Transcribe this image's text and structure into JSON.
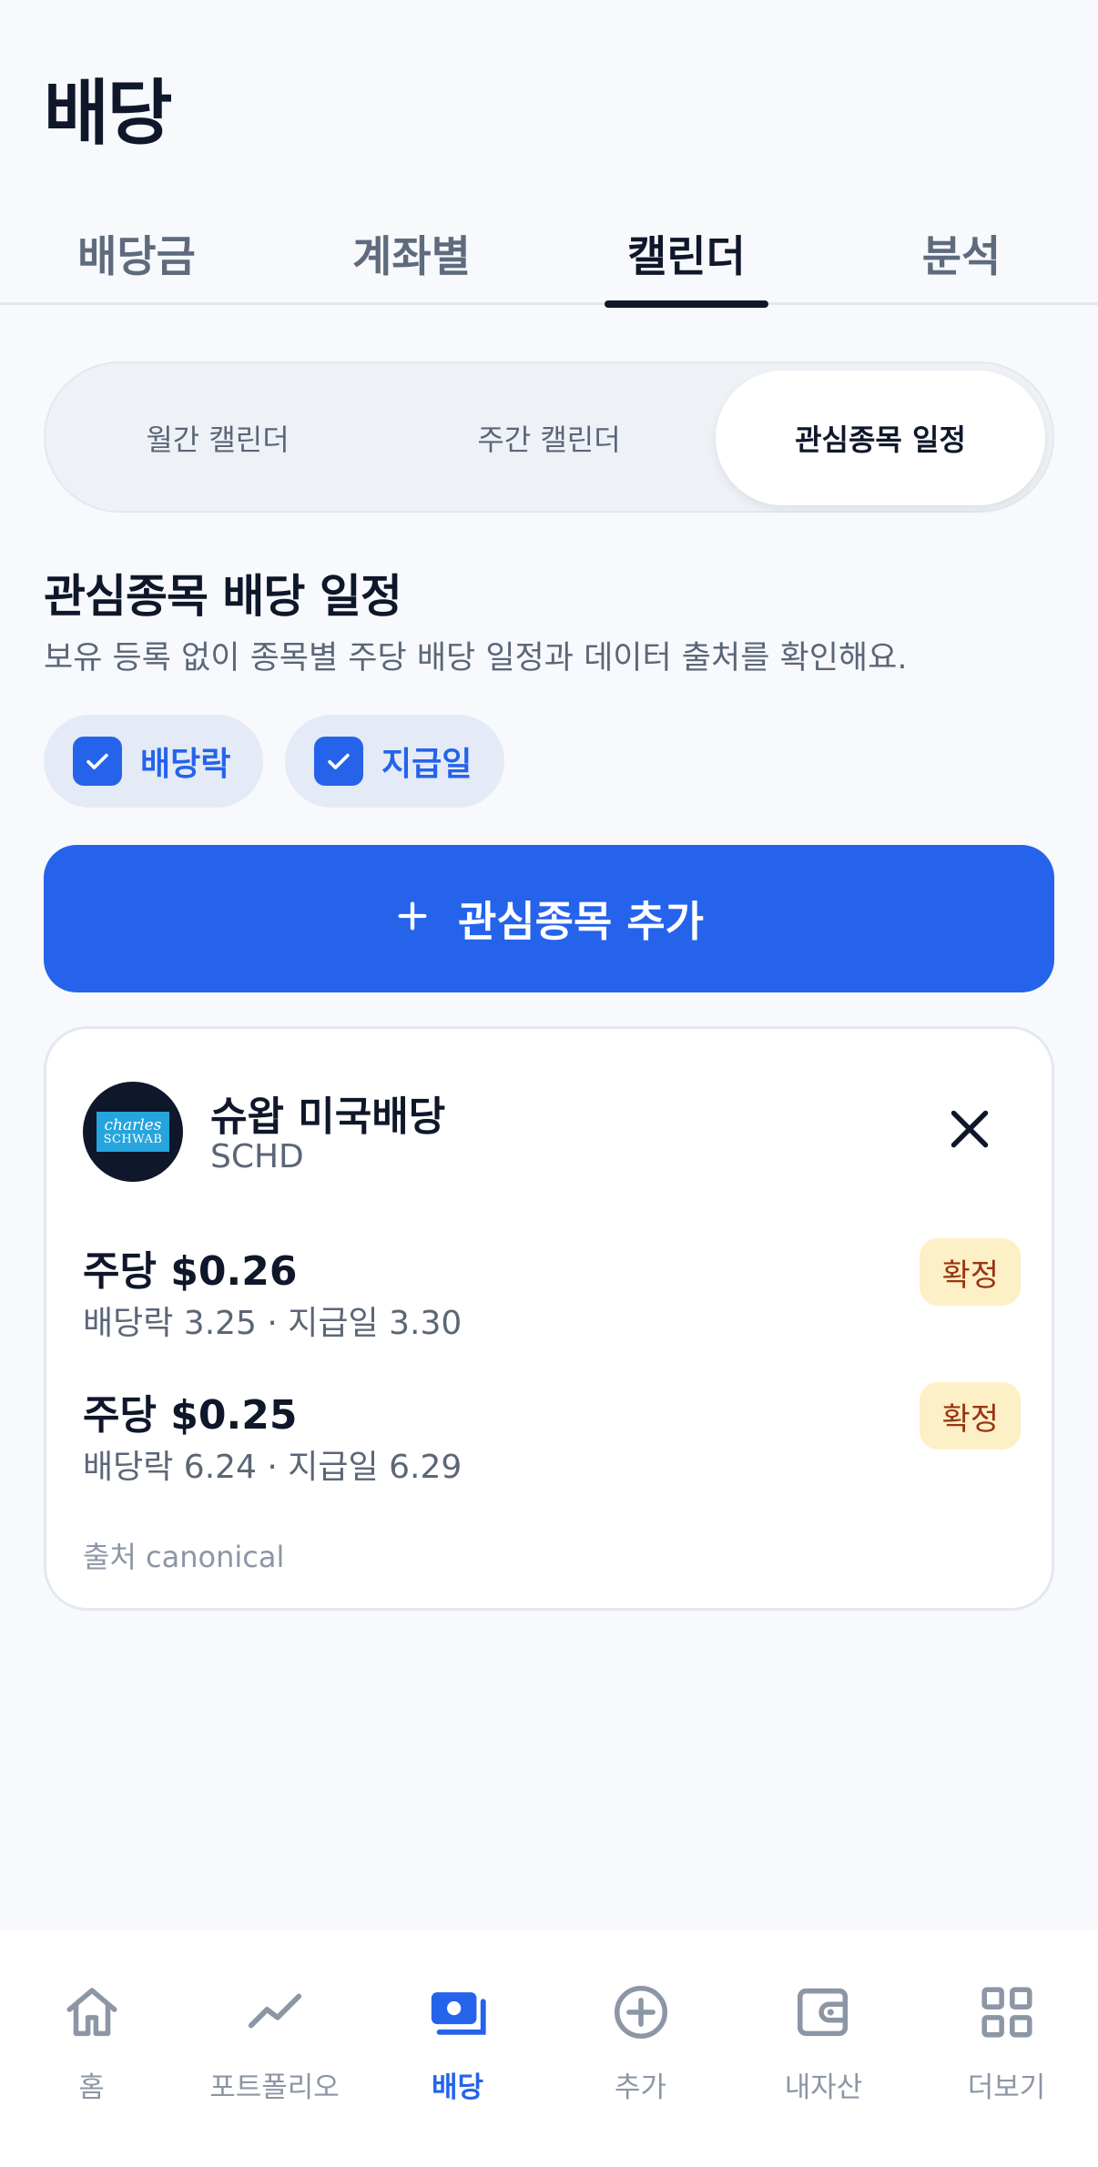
{
  "page": {
    "title": "배당"
  },
  "tabs": [
    {
      "label": "배당금"
    },
    {
      "label": "계좌별"
    },
    {
      "label": "캘린더",
      "active": true
    },
    {
      "label": "분석"
    }
  ],
  "segments": [
    {
      "label": "월간 캘린더"
    },
    {
      "label": "주간 캘린더"
    },
    {
      "label": "관심종목 일정",
      "active": true
    }
  ],
  "section": {
    "title": "관심종목 배당 일정",
    "description": "보유 등록 없이 종목별 주당 배당 일정과 데이터 출처를 확인해요."
  },
  "filters": [
    {
      "label": "배당락",
      "checked": true
    },
    {
      "label": "지급일",
      "checked": true
    }
  ],
  "add_button": {
    "label": "관심종목 추가",
    "icon": "plus-icon"
  },
  "card": {
    "logo_text_1": "charles",
    "logo_text_2": "SCHWAB",
    "name": "슈왑 미국배당",
    "ticker": "SCHD",
    "dividends": [
      {
        "amount": "주당 $0.26",
        "dates": "배당락 3.25 · 지급일 3.30",
        "badge": "확정"
      },
      {
        "amount": "주당 $0.25",
        "dates": "배당락 6.24 · 지급일 6.29",
        "badge": "확정"
      }
    ],
    "source": "출처 canonical"
  },
  "colors": {
    "accent": "#2563eb",
    "badge_bg": "#fdf0c6",
    "badge_text": "#9a3412"
  },
  "bottom_nav": [
    {
      "label": "홈",
      "icon": "home-icon"
    },
    {
      "label": "포트폴리오",
      "icon": "trend-line-icon"
    },
    {
      "label": "배당",
      "icon": "cash-icon",
      "active": true
    },
    {
      "label": "추가",
      "icon": "plus-circle-icon"
    },
    {
      "label": "내자산",
      "icon": "wallet-icon"
    },
    {
      "label": "더보기",
      "icon": "grid-icon"
    }
  ]
}
